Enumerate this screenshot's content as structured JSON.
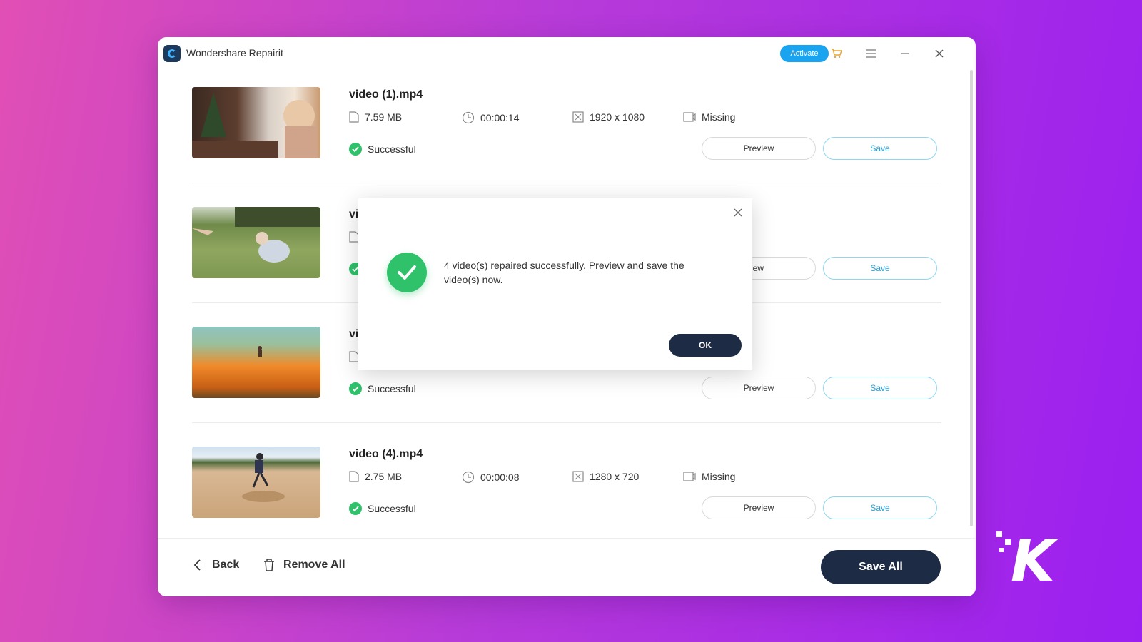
{
  "window": {
    "title": "Wondershare Repairit",
    "activate_label": "Activate"
  },
  "videos": [
    {
      "name": "video (1).mp4",
      "size": "7.59  MB",
      "duration": "00:00:14",
      "resolution": "1920 x 1080",
      "audio": "Missing",
      "status": "Successful",
      "preview_label": "Preview",
      "save_label": "Save"
    },
    {
      "name": "vi",
      "size": "",
      "duration": "",
      "resolution": "",
      "audio": "",
      "status": "",
      "preview_label": "iew",
      "save_label": "Save"
    },
    {
      "name": "vi",
      "size": "",
      "duration": "",
      "resolution": "",
      "audio": "",
      "status": "Successful",
      "preview_label": "Preview",
      "save_label": "Save"
    },
    {
      "name": "video (4).mp4",
      "size": "2.75  MB",
      "duration": "00:00:08",
      "resolution": "1280 x 720",
      "audio": "Missing",
      "status": "Successful",
      "preview_label": "Preview",
      "save_label": "Save"
    }
  ],
  "footer": {
    "back_label": "Back",
    "remove_all_label": "Remove All",
    "save_all_label": "Save All"
  },
  "dialog": {
    "message": "4 video(s) repaired successfully. Preview and save the video(s) now.",
    "ok_label": "OK"
  },
  "colors": {
    "accent": "#1aa3ef",
    "success": "#2fc26b",
    "primary_dark": "#1e2b45"
  }
}
